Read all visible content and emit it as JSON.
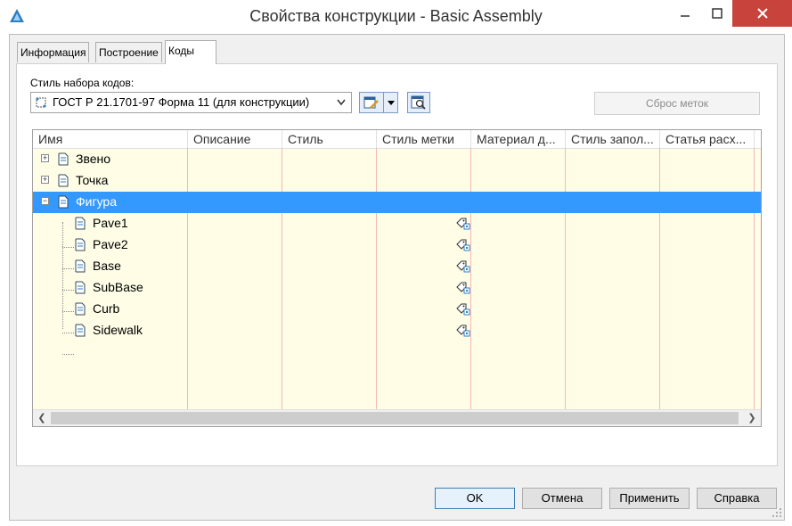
{
  "window": {
    "title": "Свойства конструкции - Basic Assembly"
  },
  "tabs": [
    {
      "label": "Информация"
    },
    {
      "label": "Построение"
    },
    {
      "label": "Коды"
    }
  ],
  "codeset": {
    "label": "Стиль набора кодов:",
    "selected": "ГОСТ Р 21.1701-97 Форма 11 (для конструкции)",
    "reset_label": "Сброс меток"
  },
  "table": {
    "columns": [
      "Имя",
      "Описание",
      "Стиль",
      "Стиль метки",
      "Материал д...",
      "Стиль запол...",
      "Статья расх..."
    ],
    "rows": [
      {
        "name": "Звено",
        "expander": "+",
        "selected": false,
        "has_tag": false
      },
      {
        "name": "Точка",
        "expander": "+",
        "selected": false,
        "has_tag": false
      },
      {
        "name": "Фигура",
        "expander": "−",
        "selected": true,
        "has_tag": false
      },
      {
        "name": "Pave1",
        "selected": false,
        "has_tag": true
      },
      {
        "name": "Pave2",
        "selected": false,
        "has_tag": true
      },
      {
        "name": "Base",
        "selected": false,
        "has_tag": true
      },
      {
        "name": "SubBase",
        "selected": false,
        "has_tag": true
      },
      {
        "name": "Curb",
        "selected": false,
        "has_tag": true
      },
      {
        "name": "Sidewalk",
        "selected": false,
        "has_tag": true
      }
    ]
  },
  "buttons": {
    "ok": "OK",
    "cancel": "Отмена",
    "apply": "Применить",
    "help": "Справка"
  },
  "colors": {
    "selection": "#3399ff",
    "grid_bg": "#fffde6",
    "close_button": "#c7433b"
  }
}
